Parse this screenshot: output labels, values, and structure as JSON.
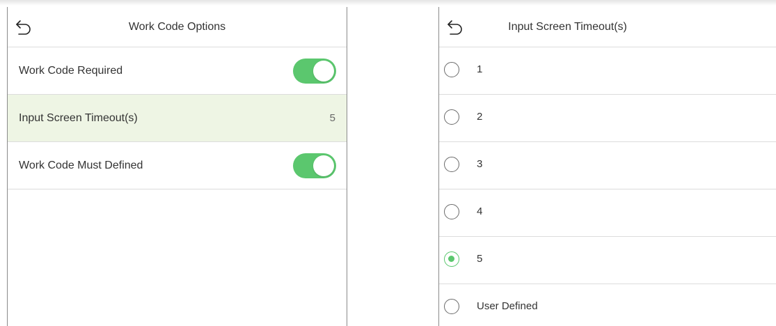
{
  "left_panel": {
    "title": "Work Code Options",
    "rows": [
      {
        "label": "Work Code Required",
        "toggle_on": true
      },
      {
        "label": "Input Screen Timeout(s)",
        "value": "5"
      },
      {
        "label": "Work Code Must Defined",
        "toggle_on": true
      }
    ]
  },
  "right_panel": {
    "title": "Input Screen Timeout(s)",
    "options": [
      {
        "label": "1",
        "selected": false
      },
      {
        "label": "2",
        "selected": false
      },
      {
        "label": "3",
        "selected": false
      },
      {
        "label": "4",
        "selected": false
      },
      {
        "label": "5",
        "selected": true
      },
      {
        "label": "User Defined",
        "selected": false
      }
    ]
  },
  "icons": {
    "back": "back-arrow-icon"
  },
  "colors": {
    "accent_green": "#5bc76e",
    "selected_row_bg": "#eef5e4",
    "divider": "#dcdcdc"
  }
}
